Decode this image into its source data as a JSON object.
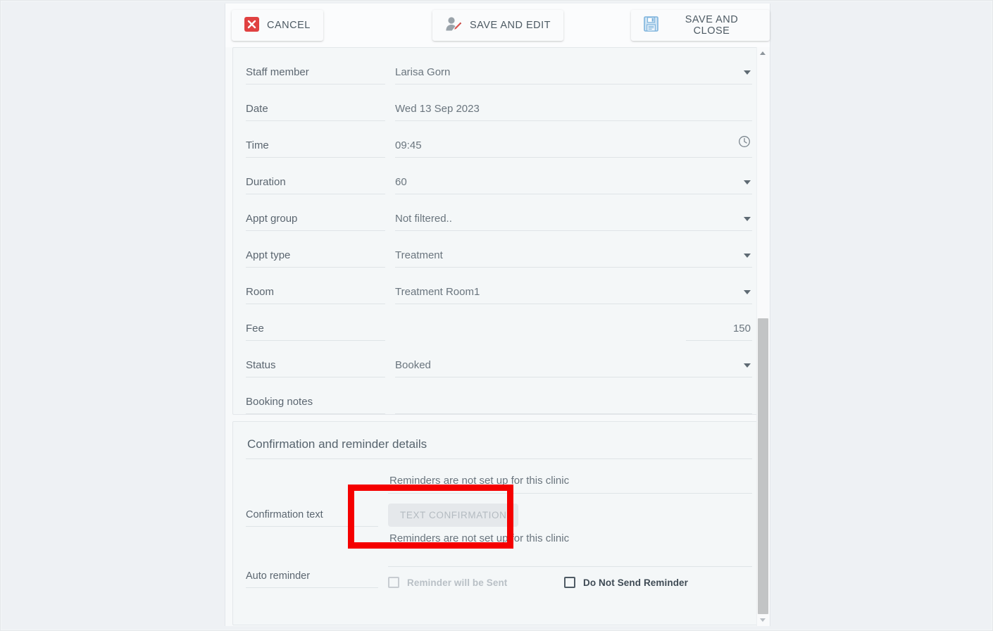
{
  "toolbar": {
    "cancel_label": "CANCEL",
    "save_and_edit_label": "SAVE AND EDIT",
    "save_and_close_label": "SAVE AND CLOSE"
  },
  "appointment_form": {
    "fields": [
      {
        "label": "Staff member",
        "value": "Larisa Gorn",
        "control": "select"
      },
      {
        "label": "Date",
        "value": "Wed 13 Sep 2023",
        "control": "text"
      },
      {
        "label": "Time",
        "value": "09:45",
        "control": "time"
      },
      {
        "label": "Duration",
        "value": "60",
        "control": "select"
      },
      {
        "label": "Appt group",
        "value": "Not filtered..",
        "control": "select"
      },
      {
        "label": "Appt type",
        "value": "Treatment",
        "control": "select"
      },
      {
        "label": "Room",
        "value": "Treatment Room1",
        "control": "select"
      },
      {
        "label": "Fee",
        "value": "150",
        "control": "number"
      },
      {
        "label": "Status",
        "value": "Booked",
        "control": "select"
      },
      {
        "label": "Booking notes",
        "value": "",
        "control": "text"
      }
    ]
  },
  "confirmation_section": {
    "title": "Confirmation and reminder details",
    "confirmation_text_label": "Confirmation text",
    "confirmation_note": "Reminders are not set up for this clinic",
    "text_confirmation_button": "TEXT CONFIRMATION",
    "auto_reminder_label": "Auto reminder",
    "auto_reminder_note": "Reminders are not set up for this clinic",
    "checkboxes": [
      {
        "label": "Reminder will be Sent",
        "checked": false,
        "disabled": true
      },
      {
        "label": "Do Not Send Reminder",
        "checked": false,
        "disabled": false
      }
    ]
  },
  "annotation": {
    "color": "#f50000"
  },
  "colors": {
    "cancel_icon": "#e04141",
    "save_edit_pencil": "#d9534f",
    "save_close_icon": "#7fb4dd",
    "page_background": "#eef1f4",
    "card_background": "#f4f7f8"
  }
}
